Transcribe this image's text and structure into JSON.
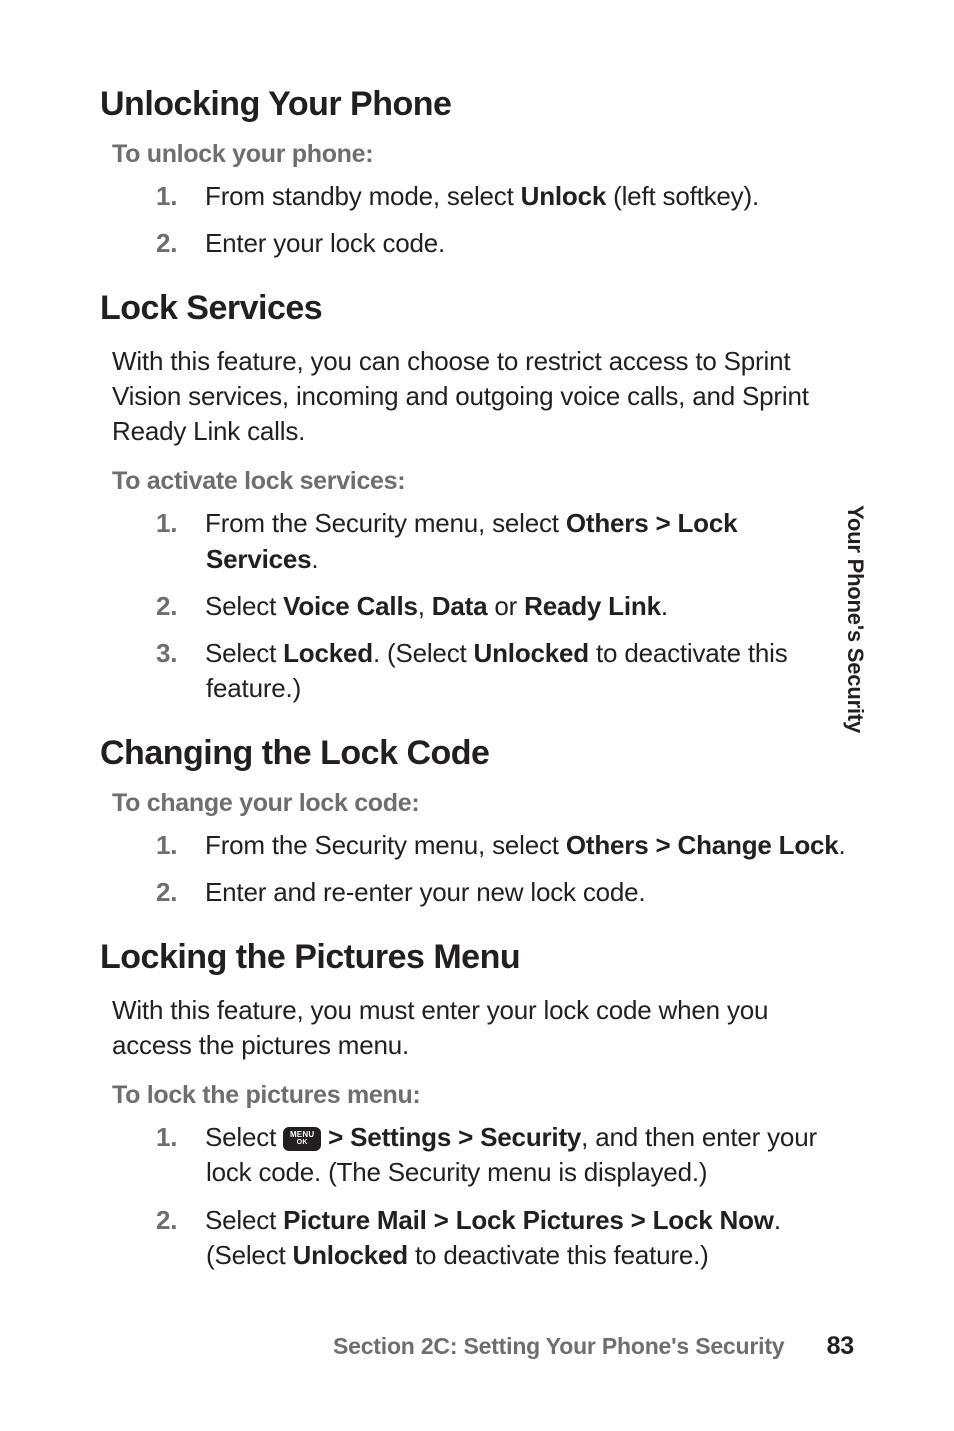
{
  "sideTab": "Your Phone's Security",
  "sections": {
    "unlocking": {
      "heading": "Unlocking Your Phone",
      "subhead": "To unlock your phone:",
      "step1_pre": "From standby mode, select ",
      "step1_bold": "Unlock",
      "step1_post": " (left softkey).",
      "step2": "Enter your lock code."
    },
    "lockServices": {
      "heading": "Lock Services",
      "intro": "With this feature, you can choose to restrict access to Sprint Vision services, incoming and outgoing voice calls, and Sprint Ready Link calls.",
      "subhead": "To activate lock services:",
      "step1_pre": "From the Security menu, select ",
      "step1_bold": "Others > Lock Services",
      "step1_post": ".",
      "step2_pre": "Select ",
      "step2_b1": "Voice Calls",
      "step2_mid1": ", ",
      "step2_b2": "Data",
      "step2_mid2": " or ",
      "step2_b3": "Ready Link",
      "step2_post": ".",
      "step3_pre": "Select ",
      "step3_b1": "Locked",
      "step3_mid": ". (Select ",
      "step3_b2": "Unlocked",
      "step3_post": " to deactivate this feature.)"
    },
    "changingLock": {
      "heading": "Changing the Lock Code",
      "subhead": "To change your lock code:",
      "step1_pre": "From the Security menu, select ",
      "step1_bold": "Others > Change Lock",
      "step1_post": ".",
      "step2": "Enter and re-enter your new lock code."
    },
    "lockingPictures": {
      "heading": "Locking the Pictures Menu",
      "intro": "With this feature, you must enter your lock code when you access the pictures menu.",
      "subhead": "To lock the pictures menu:",
      "step1_pre": "Select ",
      "step1_iconTop": "MENU",
      "step1_iconBot": "OK",
      "step1_mid1": " ",
      "step1_bold": "> Settings > Security",
      "step1_post": ", and then enter your lock code. (The Security menu is displayed.)",
      "step2_pre": "Select ",
      "step2_b1": "Picture Mail > Lock Pictures > Lock Now",
      "step2_mid": ". (Select ",
      "step2_b2": "Unlocked",
      "step2_post": " to deactivate this feature.)"
    }
  },
  "footer": {
    "sectionLabel": "Section 2C: Setting Your Phone's Security",
    "pageNumber": "83"
  }
}
